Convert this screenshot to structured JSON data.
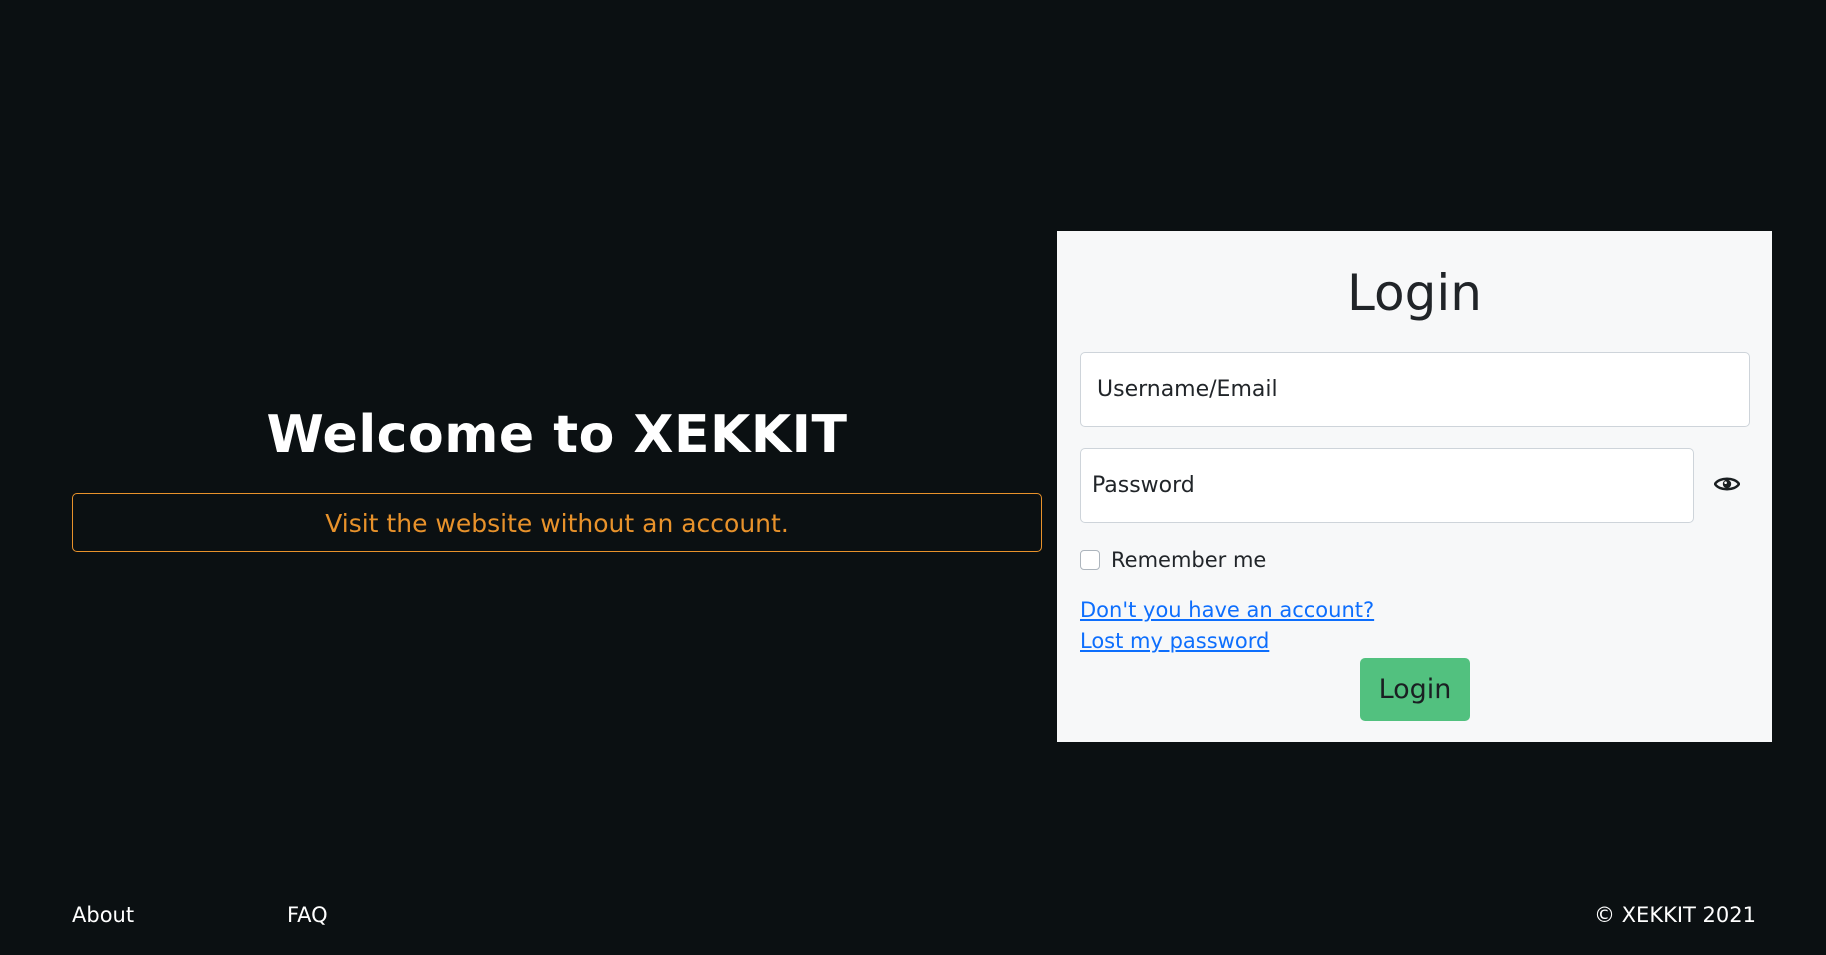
{
  "hero": {
    "title": "Welcome to XEKKIT",
    "guest_label": "Visit the website without an account."
  },
  "login": {
    "title": "Login",
    "username_placeholder": "Username/Email",
    "password_placeholder": "Password",
    "remember_label": "Remember me",
    "register_link": "Don't you have an account?",
    "lost_password_link": "Lost my password",
    "submit_label": "Login"
  },
  "footer": {
    "about": "About",
    "faq": "FAQ",
    "copyright": "© XEKKIT 2021"
  },
  "icons": {
    "password_toggle": "eye-icon"
  },
  "colors": {
    "background": "#0b1012",
    "accent_orange": "#e8922b",
    "login_green": "#52c17f",
    "link_blue": "#0d6efd"
  }
}
